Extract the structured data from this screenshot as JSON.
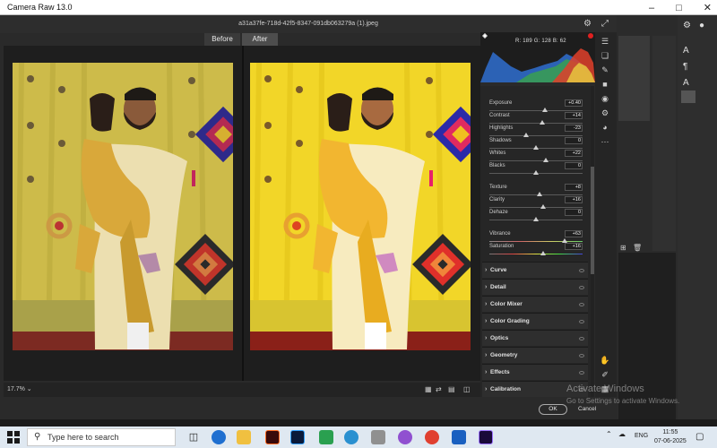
{
  "window": {
    "title": "Camera Raw 13.0"
  },
  "file": {
    "name": "a31a37fe-718d-42f5-8347-091db063279a (1).jpeg"
  },
  "view_tabs": [
    "Before",
    "After"
  ],
  "histogram": {
    "readout": "R: 189   G: 128   B: 62"
  },
  "basic": {
    "sliders": [
      {
        "label": "Exposure",
        "value": "+0.40",
        "pos": 0.6
      },
      {
        "label": "Contrast",
        "value": "+14",
        "pos": 0.57
      },
      {
        "label": "Highlights",
        "value": "-23",
        "pos": 0.39
      },
      {
        "label": "Shadows",
        "value": "0",
        "pos": 0.5
      },
      {
        "label": "Whites",
        "value": "+22",
        "pos": 0.61
      },
      {
        "label": "Blacks",
        "value": "0",
        "pos": 0.5
      },
      {
        "label": "Texture",
        "value": "+8",
        "pos": 0.54
      },
      {
        "label": "Clarity",
        "value": "+16",
        "pos": 0.58
      },
      {
        "label": "Dehaze",
        "value": "0",
        "pos": 0.5
      },
      {
        "label": "Vibrance",
        "value": "+63",
        "pos": 0.81
      },
      {
        "label": "Saturation",
        "value": "+16",
        "pos": 0.58
      }
    ]
  },
  "sections": [
    "Curve",
    "Detail",
    "Color Mixer",
    "Color Grading",
    "Optics",
    "Geometry",
    "Effects",
    "Calibration"
  ],
  "zoom": "17.7%",
  "buttons": {
    "ok": "OK",
    "cancel": "Cancel"
  },
  "watermark": {
    "line1": "Activate Windows",
    "line2": "Go to Settings to activate Windows."
  },
  "taskbar": {
    "search_placeholder": "Type here to search",
    "language": "ENG",
    "time": "11:55",
    "date": "07-06-2025"
  },
  "colors": {
    "accent_yellow": "#f2d628",
    "panel_bg": "#262626",
    "taskbar_bg": "#dfe8f1"
  }
}
